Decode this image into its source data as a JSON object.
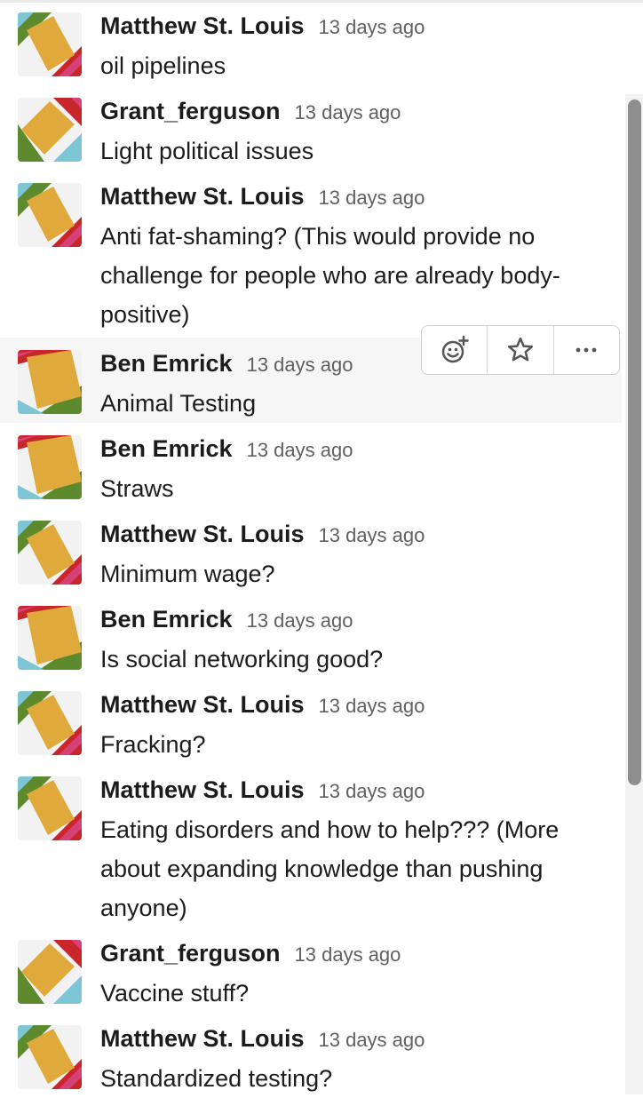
{
  "messages": [
    {
      "name": "Matthew St. Louis",
      "time": "13 days ago",
      "lines": [
        "oil pipelines"
      ],
      "avatar": "matthew"
    },
    {
      "name": "Grant_ferguson",
      "time": "13 days ago",
      "lines": [
        "Light political issues"
      ],
      "avatar": "grant"
    },
    {
      "name": "Matthew St. Louis",
      "time": "13 days ago",
      "lines": [
        "Anti fat-shaming? (This would provide no",
        "challenge for people who are already body-",
        "positive)"
      ],
      "avatar": "matthew"
    },
    {
      "name": "Ben Emrick",
      "time": "13 days ago",
      "lines": [
        "Animal Testing"
      ],
      "avatar": "ben"
    },
    {
      "name": "Ben Emrick",
      "time": "13 days ago",
      "lines": [
        "Straws"
      ],
      "avatar": "ben"
    },
    {
      "name": "Matthew St. Louis",
      "time": "13 days ago",
      "lines": [
        "Minimum wage?"
      ],
      "avatar": "matthew"
    },
    {
      "name": "Ben Emrick",
      "time": "13 days ago",
      "lines": [
        "Is social networking good?"
      ],
      "avatar": "ben"
    },
    {
      "name": "Matthew St. Louis",
      "time": "13 days ago",
      "lines": [
        "Fracking?"
      ],
      "avatar": "matthew"
    },
    {
      "name": "Matthew St. Louis",
      "time": "13 days ago",
      "lines": [
        "Eating disorders and how to help??? (More",
        "about expanding knowledge than pushing",
        "anyone)"
      ],
      "avatar": "matthew"
    },
    {
      "name": "Grant_ferguson",
      "time": "13 days ago",
      "lines": [
        "Vaccine stuff?"
      ],
      "avatar": "grant"
    },
    {
      "name": "Matthew St. Louis",
      "time": "13 days ago",
      "lines": [
        "Standardized testing?"
      ],
      "avatar": "matthew"
    }
  ],
  "hover_actions": [
    {
      "icon": "add-reaction-icon"
    },
    {
      "icon": "star-icon"
    },
    {
      "icon": "more-actions-icon"
    }
  ],
  "colors": {
    "avatar_yellow": "#e0a93b",
    "avatar_green": "#5d8a2e",
    "avatar_red": "#c9262c",
    "avatar_pink": "#d64277",
    "avatar_blue": "#7ec5d6",
    "avatar_white": "#f2f2f2",
    "hover_bg": "#f6f6f6"
  }
}
